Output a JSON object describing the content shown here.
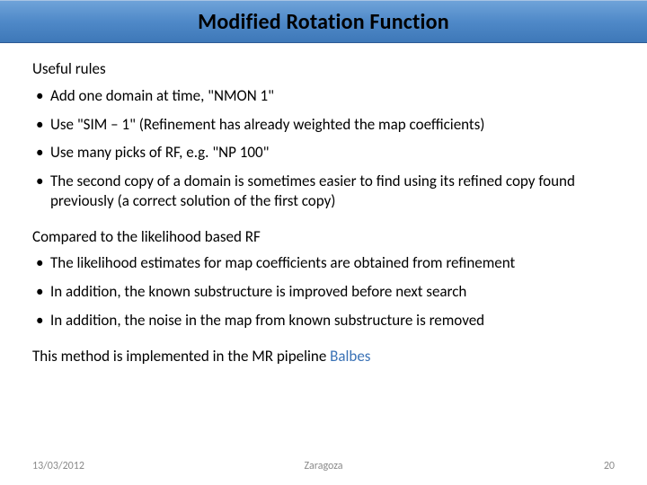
{
  "title": "Modified Rotation Function",
  "section1": {
    "heading": "Useful rules",
    "items": [
      "Add one domain at time, \"NMON 1\"",
      "Use \"SIM – 1\" (Refinement has already weighted the map coefficients)",
      "Use many picks of RF, e.g. \"NP 100\"",
      "The second copy of a domain is sometimes easier to find using its refined copy found previously (a correct solution of the first copy)"
    ]
  },
  "section2": {
    "heading": "Compared to the likelihood based RF",
    "items": [
      "The likelihood estimates for map coefficients are obtained from refinement",
      "In addition, the known substructure is improved before next search",
      "In addition, the noise in the map from known substructure is removed"
    ]
  },
  "implemented_prefix": "This method is implemented in the MR pipeline ",
  "implemented_link": "Balbes",
  "footer": {
    "date": "13/03/2012",
    "location": "Zaragoza",
    "page": "20"
  }
}
